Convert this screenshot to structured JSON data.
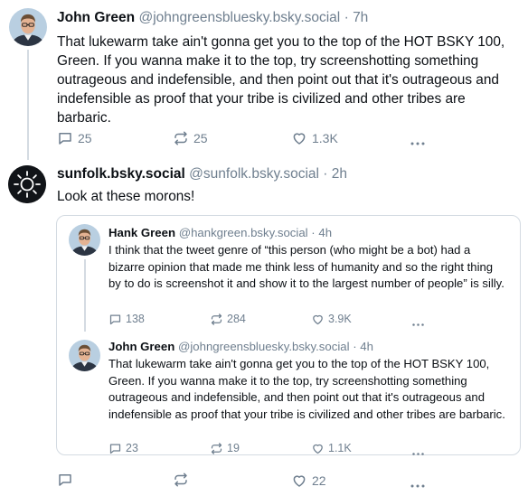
{
  "post1": {
    "author_name": "John Green",
    "author_handle": "@johngreensbluesky.bsky.social",
    "separator": "·",
    "time": "7h",
    "text": "That lukewarm take ain't gonna get you to the top of the HOT BSKY 100, Green. If you wanna make it to the top, try screenshotting something outrageous and indefensible, and then point out that it's outrageous and indefensible as proof that your tribe is civilized and other tribes are barbaric.",
    "replies": "25",
    "reposts": "25",
    "likes": "1.3K"
  },
  "post2": {
    "author_name": "sunfolk.bsky.social",
    "author_handle": "@sunfolk.bsky.social",
    "separator": "·",
    "time": "2h",
    "text": "Look at these morons!",
    "likes": "22",
    "quote": {
      "first": {
        "author_name": "Hank Green",
        "author_handle": "@hankgreen.bsky.social",
        "separator": "·",
        "time": "4h",
        "text": "I think that the tweet genre of “this person (who might be a bot) had a bizarre opinion that made me think less of humanity and so the right thing by to do is screenshot it and show it to the largest number of people” is silly.",
        "replies": "138",
        "reposts": "284",
        "likes": "3.9K"
      },
      "second": {
        "author_name": "John Green",
        "author_handle": "@johngreensbluesky.bsky.social",
        "separator": "·",
        "time": "4h",
        "text": "That lukewarm take ain't gonna get you to the top of the HOT BSKY 100, Green. If you wanna make it to the top, try screenshotting something outrageous and indefensible, and then point out that it's outrageous and indefensible as proof that your tribe is civilized and other tribes are barbaric.",
        "replies": "23",
        "reposts": "19",
        "likes": "1.1K"
      }
    }
  },
  "icons": {
    "reply": "speech-bubble-icon",
    "repost": "repost-arrows-icon",
    "like": "heart-icon",
    "more": "ellipsis-icon",
    "sun_logo": "sun-icon"
  },
  "colors": {
    "text": "#0b0f14",
    "muted": "#6f7f8f",
    "border": "#d4dbe2"
  }
}
